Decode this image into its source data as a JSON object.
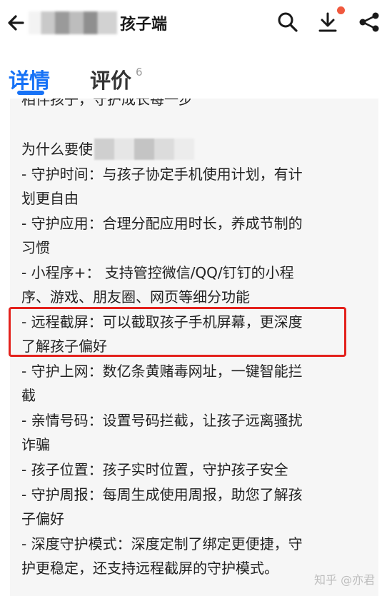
{
  "header": {
    "app_title": "孩子端",
    "icons": [
      "back-arrow-icon",
      "search-icon",
      "download-icon",
      "share-icon"
    ],
    "notification_dot_color": "#f0593e"
  },
  "tabs": {
    "detail_label": "详情",
    "review_label": "评价",
    "review_count": "6",
    "active_color": "#1772f6"
  },
  "content": {
    "cut_line": "相伴孩子，守护成长每一步",
    "why_prefix": "为什么要使",
    "lines": [
      "- 守护时间：与孩子协定手机使用计划，有计",
      "划更自由",
      "- 守护应用：合理分配应用时长，养成节制的",
      "习惯",
      "- 小程序+： 支持管控微信/QQ/钉钉的小程",
      "序、游戏、朋友圈、网页等细分功能",
      "- 远程截屏：可以截取孩子手机屏幕，更深度",
      "了解孩子偏好",
      "- 守护上网：数亿条黄赌毒网址，一键智能拦",
      "截",
      "- 亲情号码：设置号码拦截，让孩子远离骚扰",
      "诈骗",
      "- 孩子位置：孩子实时位置，守护孩子安全",
      "- 守护周报：每周生成使用周报，助您了解孩",
      "子偏好",
      "- 深度守护模式：深度定制了绑定更便捷，守",
      "护更稳定，还支持远程截屏的守护模式。"
    ],
    "highlight_color": "#e3211c"
  },
  "watermark": "知乎 @亦君"
}
